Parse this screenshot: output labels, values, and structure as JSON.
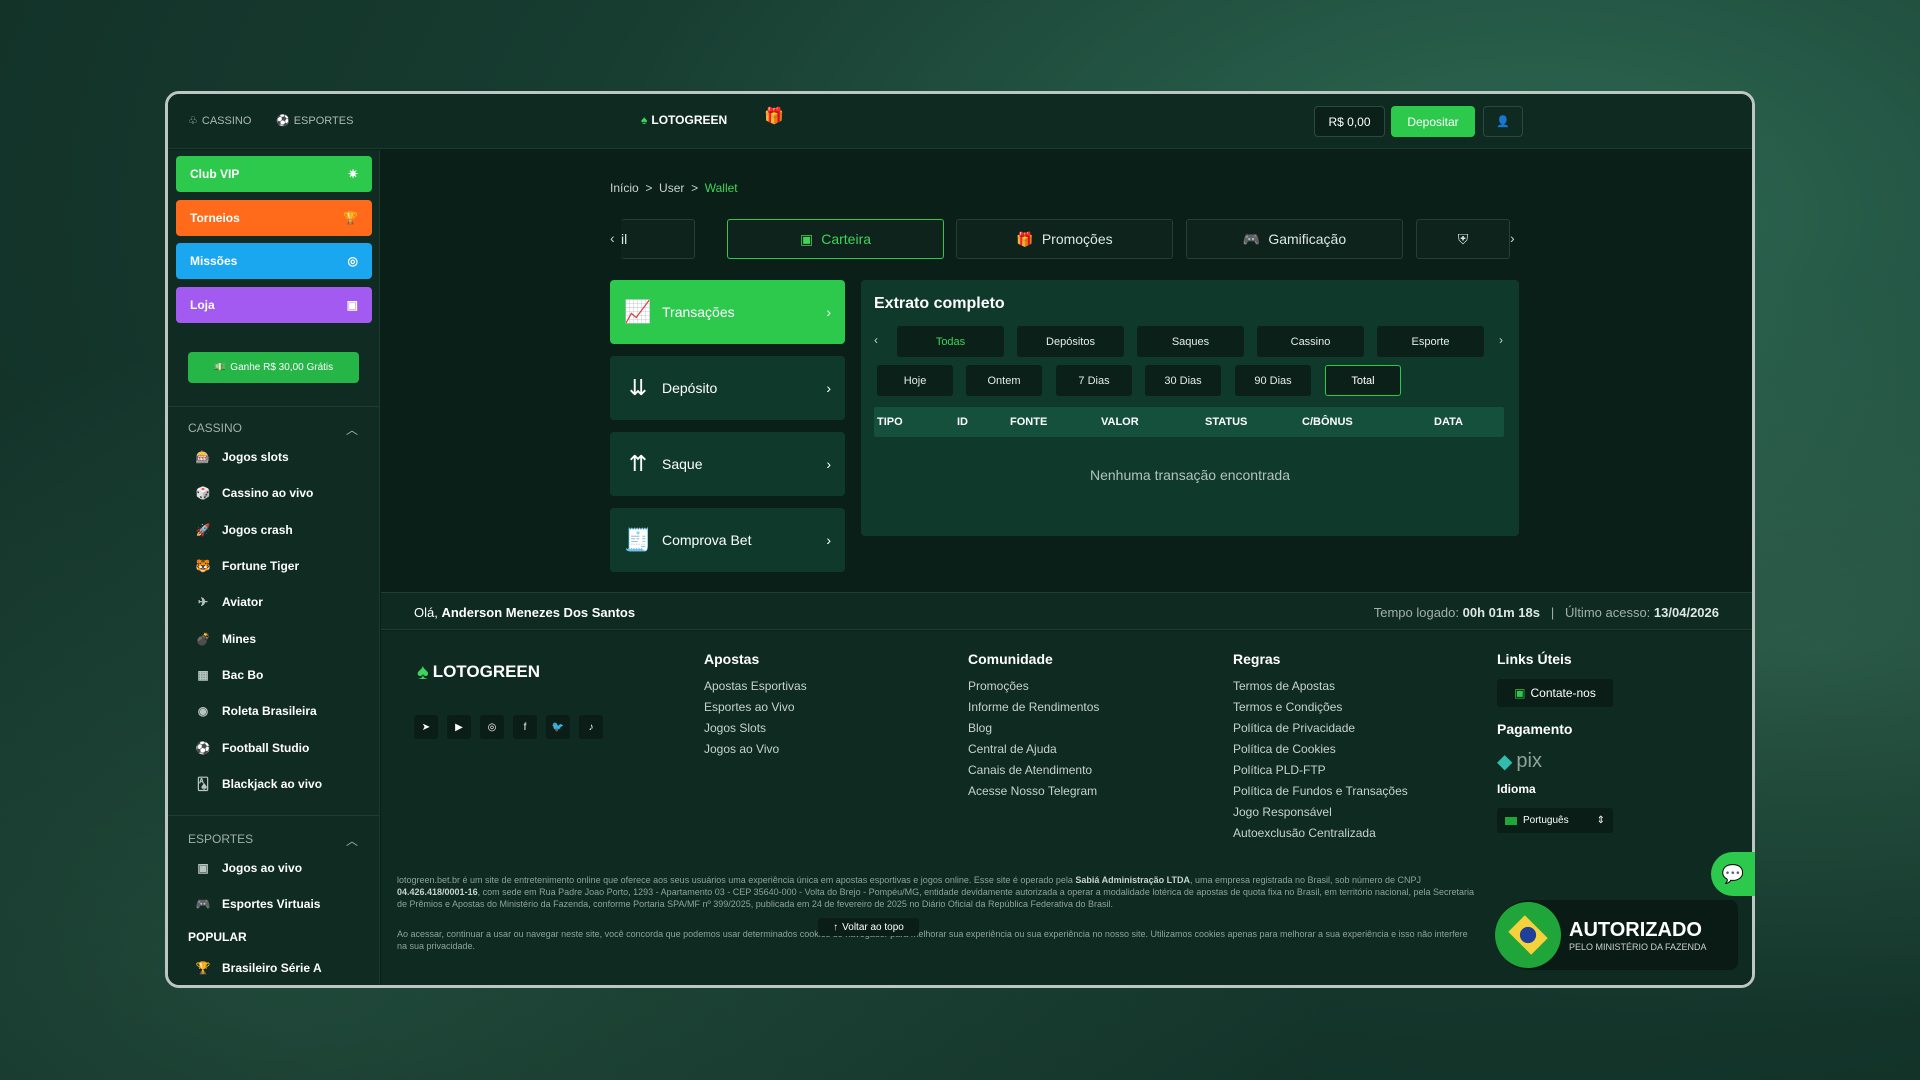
{
  "header": {
    "cassino": "CASSINO",
    "esportes": "ESPORTES",
    "logo": "LOTOGREEN",
    "balance": "R$ 0,00",
    "deposit": "Depositar"
  },
  "sidebar": {
    "promos": [
      "Club VIP",
      "Torneios",
      "Missões",
      "Loja"
    ],
    "ganhe": "Ganhe R$ 30,00 Grátis",
    "cassino_title": "CASSINO",
    "cassino_items": [
      "Jogos slots",
      "Cassino ao vivo",
      "Jogos crash",
      "Fortune Tiger",
      "Aviator",
      "Mines",
      "Bac Bo",
      "Roleta Brasileira",
      "Football Studio",
      "Blackjack ao vivo"
    ],
    "esportes_title": "ESPORTES",
    "esportes_items": [
      "Jogos ao vivo",
      "Esportes Virtuais"
    ],
    "popular_title": "POPULAR",
    "popular_items": [
      "Brasileiro Série A"
    ]
  },
  "breadcrumb": {
    "home": "Início",
    "sep": ">",
    "user": "User",
    "current": "Wallet"
  },
  "tabs": {
    "partial": "il",
    "carteira": "Carteira",
    "promocoes": "Promoções",
    "gamificacao": "Gamificação"
  },
  "wallet_menu": [
    "Transações",
    "Depósito",
    "Saque",
    "Comprova Bet"
  ],
  "statement": {
    "title": "Extrato completo",
    "categories": [
      "Todas",
      "Depósitos",
      "Saques",
      "Cassino",
      "Esporte"
    ],
    "periods": [
      "Hoje",
      "Ontem",
      "7 Dias",
      "30 Dias",
      "90 Dias",
      "Total"
    ],
    "columns": [
      "TIPO",
      "ID",
      "FONTE",
      "VALOR",
      "STATUS",
      "C/BÔNUS",
      "DATA"
    ],
    "empty": "Nenhuma transação encontrada"
  },
  "infobar": {
    "greeting": "Olá,",
    "name": "Anderson Menezes Dos Santos",
    "logged_label": "Tempo logado:",
    "logged": "00h 01m 18s",
    "sep": "|",
    "access_label": "Último acesso:",
    "access": "13/04/2026"
  },
  "footer": {
    "logo": "LOTOGREEN",
    "apostas": {
      "title": "Apostas",
      "links": [
        "Apostas Esportivas",
        "Esportes ao Vivo",
        "Jogos Slots",
        "Jogos ao Vivo"
      ]
    },
    "comunidade": {
      "title": "Comunidade",
      "links": [
        "Promoções",
        "Informe de Rendimentos",
        "Blog",
        "Central de Ajuda",
        "Canais de Atendimento",
        "Acesse Nosso Telegram"
      ]
    },
    "regras": {
      "title": "Regras",
      "links": [
        "Termos de Apostas",
        "Termos e Condições",
        "Política de Privacidade",
        "Política de Cookies",
        "Política PLD-FTP",
        "Política de Fundos e Transações",
        "Jogo Responsável",
        "Autoexclusão Centralizada"
      ]
    },
    "links_uteis": {
      "title": "Links Úteis",
      "contact": "Contate-nos"
    },
    "pagamento": {
      "title": "Pagamento",
      "pix": "pix"
    },
    "idioma": {
      "title": "Idioma",
      "value": "Português"
    },
    "legal1_a": "lotogreen.bet.br é um site de entretenimento online que oferece aos seus usuários uma experiência única em apostas esportivas e jogos online. Esse site é operado pela ",
    "legal1_b": "Sabiá Administração LTDA",
    "legal1_c": ", uma empresa registrada no Brasil, sob número de CNPJ ",
    "legal1_d": "04.426.418/0001-16",
    "legal1_e": ", com sede em Rua Padre Joao Porto, 1293 - Apartamento 03 - CEP 35640-000 - Volta do Brejo - Pompéu/MG, entidade devidamente autorizada a operar a modalidade lotérica de apostas de quota fixa no Brasil, em território nacional, pela Secretaria de Prêmios e Apostas do Ministério da Fazenda, conforme Portaria SPA/MF nº 399/2025, publicada em 24 de fevereiro de 2025 no Diário Oficial da República Federativa do Brasil.",
    "legal2": "Ao acessar, continuar a usar ou navegar neste site, você concorda que podemos usar determinados cookies do navegador para melhorar sua experiência ou sua experiência no nosso site. Utilizamos cookies apenas para melhorar a sua experiência e isso não interfere na sua privacidade.",
    "back_top": "Voltar ao topo",
    "badge_title": "AUTORIZADO",
    "badge_sub": "PELO MINISTÉRIO DA FAZENDA"
  },
  "colors": {
    "accent": "#2cc94c",
    "panel": "#0f3a2b",
    "club": "#2cc94c",
    "torneios": "#ff6b1a",
    "missoes": "#1aa7f0",
    "loja": "#a25af0"
  }
}
